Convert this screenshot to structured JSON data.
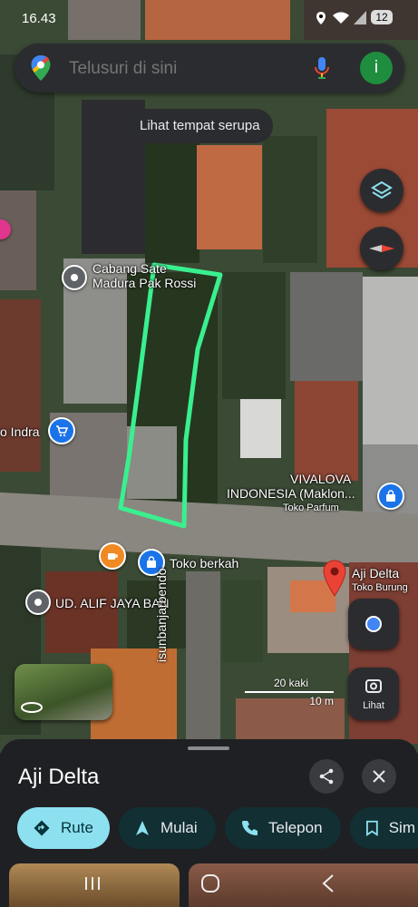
{
  "status_bar": {
    "time": "16.43",
    "battery": "12"
  },
  "search": {
    "placeholder": "Telusuri di sini",
    "avatar_letter": "i"
  },
  "similar_chip": "Lihat tempat serupa",
  "map_labels": {
    "cabang_sate_line1": "Cabang Sate",
    "cabang_sate_line2": "Madura Pak Rossi",
    "toko_indra": "o Indra",
    "vivalova_line1": "VIVALOVA",
    "vivalova_line2": "INDONESIA (Maklon...",
    "vivalova_sub": "Toko Parfum",
    "toko_berkah": "Toko berkah",
    "aji_delta": "Aji Delta",
    "aji_delta_sub": "Toko Burung",
    "ud_alif": "UD. ALIF JAYA BAN",
    "street": "isunbanjarbendo"
  },
  "scale": {
    "feet": "20 kaki",
    "meters": "10 m"
  },
  "lens_label": "Lihat",
  "place": {
    "name": "Aji Delta"
  },
  "actions": {
    "rute": "Rute",
    "mulai": "Mulai",
    "telepon": "Telepon",
    "simpan": "Sim"
  },
  "colors": {
    "accent": "#8ce0ef",
    "highlight": "#39f08f",
    "pin_red": "#ea4335",
    "pin_blue": "#1a73e8"
  }
}
